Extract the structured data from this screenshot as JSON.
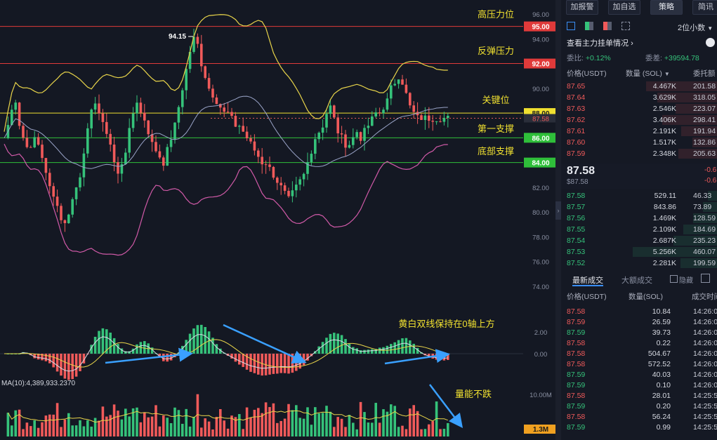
{
  "price_axis": {
    "ticks": [
      "96.00",
      "94.00",
      "92.00",
      "90.00",
      "88.00",
      "86.00",
      "84.00",
      "82.00",
      "80.00",
      "78.00",
      "76.00",
      "74.00"
    ],
    "tick_values": [
      96,
      94,
      92,
      90,
      88,
      86,
      84,
      82,
      80,
      78,
      76,
      74
    ]
  },
  "levels": [
    {
      "price": 95.0,
      "label": "95.00",
      "color": "#e03a3a",
      "text_color": "#ffffff",
      "annotation": "高压力位"
    },
    {
      "price": 92.0,
      "label": "92.00",
      "color": "#e03a3a",
      "text_color": "#ffffff",
      "annotation": "反弹压力"
    },
    {
      "price": 88.0,
      "label": "88.00",
      "color": "#f0e030",
      "text_color": "#222222",
      "annotation": "关键位"
    },
    {
      "price": 86.0,
      "label": "86.00",
      "color": "#2fbf3a",
      "text_color": "#ffffff",
      "annotation": "第一支撑"
    },
    {
      "price": 84.0,
      "label": "84.00",
      "color": "#2fbf3a",
      "text_color": "#ffffff",
      "annotation": "底部支撑"
    }
  ],
  "current_price_tag": "87.58",
  "high_marker": "94.15",
  "macd": {
    "ticks": [
      "2.00",
      "0.00"
    ],
    "annotation": "黄白双线保持在0轴上方"
  },
  "volume": {
    "ma_label": "MA(10):4,389,933.2370",
    "tick": "10.00M",
    "current_tag": "1.3M",
    "annotation": "量能不跌"
  },
  "panel": {
    "tabs": [
      "加报警",
      "加自选",
      "策略",
      "简讯"
    ],
    "orderbook_title": "查看主力挂单情况",
    "decimal_select": "2位小数",
    "ratio_label": "委比:",
    "ratio_value": "+0.12%",
    "diff_label": "委差:",
    "diff_value": "+39594.78",
    "headers": {
      "price": "价格(USDT)",
      "qty": "数量 (SOL)",
      "total": "委托额"
    },
    "asks": [
      {
        "price": "87.65",
        "qty": "4.467K",
        "total": "201.58",
        "depth": 0.78
      },
      {
        "price": "87.64",
        "qty": "3.629K",
        "total": "318.05",
        "depth": 0.65
      },
      {
        "price": "87.63",
        "qty": "2.546K",
        "total": "223.07",
        "depth": 0.45
      },
      {
        "price": "87.62",
        "qty": "3.406K",
        "total": "298.41",
        "depth": 0.6
      },
      {
        "price": "87.61",
        "qty": "2.191K",
        "total": "191.94",
        "depth": 0.39
      },
      {
        "price": "87.60",
        "qty": "1.517K",
        "total": "132.86",
        "depth": 0.27
      },
      {
        "price": "87.59",
        "qty": "2.348K",
        "total": "205.63",
        "depth": 0.42
      }
    ],
    "last_price": "87.58",
    "last_price_sub": "$87.58",
    "last_change_a": "-0.6",
    "last_change_b": "-0.6",
    "bids": [
      {
        "price": "87.58",
        "qty": "529.11",
        "total": "46.33",
        "depth": 0.1
      },
      {
        "price": "87.57",
        "qty": "843.86",
        "total": "73.89",
        "depth": 0.15
      },
      {
        "price": "87.56",
        "qty": "1.469K",
        "total": "128.59",
        "depth": 0.26
      },
      {
        "price": "87.55",
        "qty": "2.109K",
        "total": "184.69",
        "depth": 0.37
      },
      {
        "price": "87.54",
        "qty": "2.687K",
        "total": "235.23",
        "depth": 0.48
      },
      {
        "price": "87.53",
        "qty": "5.256K",
        "total": "460.07",
        "depth": 0.92
      },
      {
        "price": "87.52",
        "qty": "2.281K",
        "total": "199.59",
        "depth": 0.4
      }
    ],
    "trades_tab_active": "最新成交",
    "trades_tab_other": "大额成交",
    "trades_checkbox": "隐藏",
    "trade_headers": {
      "price": "价格(USDT)",
      "qty": "数量(SOL)",
      "time": "成交时间"
    },
    "trades": [
      {
        "price": "87.58",
        "qty": "10.84",
        "time": "14:26:0",
        "side": "sell"
      },
      {
        "price": "87.59",
        "qty": "26.59",
        "time": "14:26:0",
        "side": "sell"
      },
      {
        "price": "87.59",
        "qty": "39.73",
        "time": "14:26:0",
        "side": "buy"
      },
      {
        "price": "87.58",
        "qty": "0.22",
        "time": "14:26:0",
        "side": "sell"
      },
      {
        "price": "87.58",
        "qty": "504.67",
        "time": "14:26:0",
        "side": "sell"
      },
      {
        "price": "87.58",
        "qty": "572.52",
        "time": "14:26:0",
        "side": "sell"
      },
      {
        "price": "87.59",
        "qty": "40.03",
        "time": "14:26:0",
        "side": "buy"
      },
      {
        "price": "87.59",
        "qty": "0.10",
        "time": "14:26:0",
        "side": "buy"
      },
      {
        "price": "87.58",
        "qty": "28.01",
        "time": "14:25:5",
        "side": "sell"
      },
      {
        "price": "87.59",
        "qty": "0.20",
        "time": "14:25:5",
        "side": "buy"
      },
      {
        "price": "87.58",
        "qty": "56.24",
        "time": "14:25:5",
        "side": "sell"
      },
      {
        "price": "87.59",
        "qty": "0.99",
        "time": "14:25:5",
        "side": "buy"
      }
    ]
  },
  "colors": {
    "up": "#35c27a",
    "down": "#f05a5a",
    "ma_yellow": "#e8d44a",
    "ma_white": "#d8dbe6",
    "boll_pink": "#d15aa8",
    "arrow": "#3aa0ff"
  }
}
